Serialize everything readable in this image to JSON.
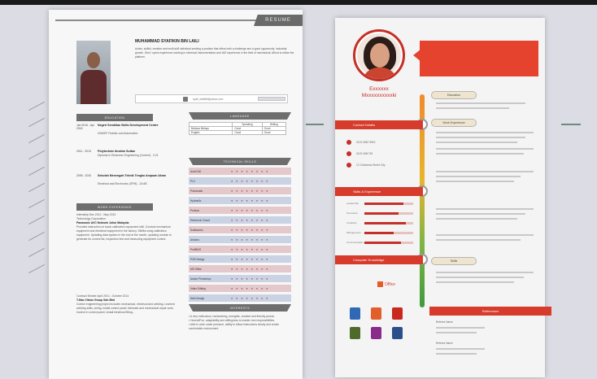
{
  "page1": {
    "resume_banner": "RESUME",
    "name": "MUHAMMAD SYAFIKIN BIN LAILI",
    "objective": "Active, skillful, creative and multi-skill individual seeking a position that offers both a challenge and a good opportunity. Industrial growth. Give I spent experience working in electrical instrumentation and I&E experience in the field of mechanical. Afford to utilize the platform.",
    "email": "syafi_lulik88@yahoo.com",
    "education_heading": "EDUCATION",
    "education": [
      {
        "years": "Jan 2016 - Apr 2016",
        "institution": "Negeri Sembilan Skills Development Centre",
        "program": "UNIKEF Robotic and Automation"
      },
      {
        "years": "2011 - 2013",
        "institution": "Polytechnic Ibrahim Sultan",
        "program": "Diploma in Electronic Engineering (Control) - 3.21"
      },
      {
        "years": "2006 - 2010",
        "institution": "Sekolah Menengah Teknik Tengku Ampuan Afzan",
        "program": "Electrical and Electronics (SPM) - 2A 6B"
      }
    ],
    "work_heading": "WORK EXPERIENCE",
    "work": [
      {
        "period": "Internship Dec 2012 - May 2013",
        "company": "Technology Corporation",
        "place": "Panasonic AVC Network Johor Malaysia",
        "description": "Provides instruction on basic calibration equipment skill. Conduct mechanical equipment and electrical equipment in the factory. Skillful using calibration equipment. Updating data system in the end of the month, updating module to generate for control list, inspection test and measuring equipment control."
      },
      {
        "period": "Contract Worker April 2014 - October 2014",
        "company": "T-Mac Vibros Group Sdn Bhd",
        "place": "",
        "description": "Control engineering project includes mechanical, electrical and welding. Learned welding skills, wiring, install control panel, fabricate and mechanical repair work. Involve in control panel, install electrical fitting..."
      }
    ],
    "language_heading": "LANGUAGE",
    "language_table": {
      "headers": [
        "",
        "Speaking",
        "Writing"
      ],
      "rows": [
        [
          "Bahasa Melayu",
          "Good",
          "Good"
        ],
        [
          "English",
          "Good",
          "Good"
        ]
      ]
    },
    "skills_heading": "TECHNICAL SKILLS",
    "skills": [
      "AutoCAD",
      "PLC",
      "Pneumatic",
      "Hydraulic",
      "Proteus",
      "Electronic Circuit",
      "Solidworks",
      "Arduino",
      "ProfiBUS",
      "PCB Design",
      "MS Office",
      "Adobe Photoshop",
      "Video Editing",
      "Web Design"
    ],
    "interests_heading": "INTERESTS",
    "interests": "• A very meticulous, hardworking, energetic, creative and friendly person.\n• Honest/Fun, adaptability and willingness to master new responsibilities.\n• Able to work under pressure, ability to follow instructions clearly and create comfortable environment."
  },
  "page2": {
    "name_line1": "Exxxxxx",
    "name_line2": "Mxxxxxxxxxxki",
    "contact_details_heading": "Contact Details",
    "skills_heading": "Skills & Experience",
    "knowledge_heading": "Computer Knowledge",
    "education_pill": "Education",
    "experience_pill": "Work Experience",
    "skills_pill": "Skills",
    "references_heading": "References",
    "office_label": "Office",
    "contact_rows": [
      "0123 4567 8901",
      "0123 4567 89",
      "12 3 Address Street City"
    ],
    "skill_labels": [
      "Leadership",
      "Teamwork",
      "Creativity",
      "Management",
      "Communication"
    ],
    "skill_levels": [
      0.8,
      0.7,
      0.85,
      0.6,
      0.75
    ],
    "reference_names": [
      "Referee Name",
      "Referee Name"
    ],
    "colors": {
      "accent": "#d63b2c",
      "timeline_top": "#f08a2e",
      "timeline_bottom": "#3f9a3c"
    }
  }
}
